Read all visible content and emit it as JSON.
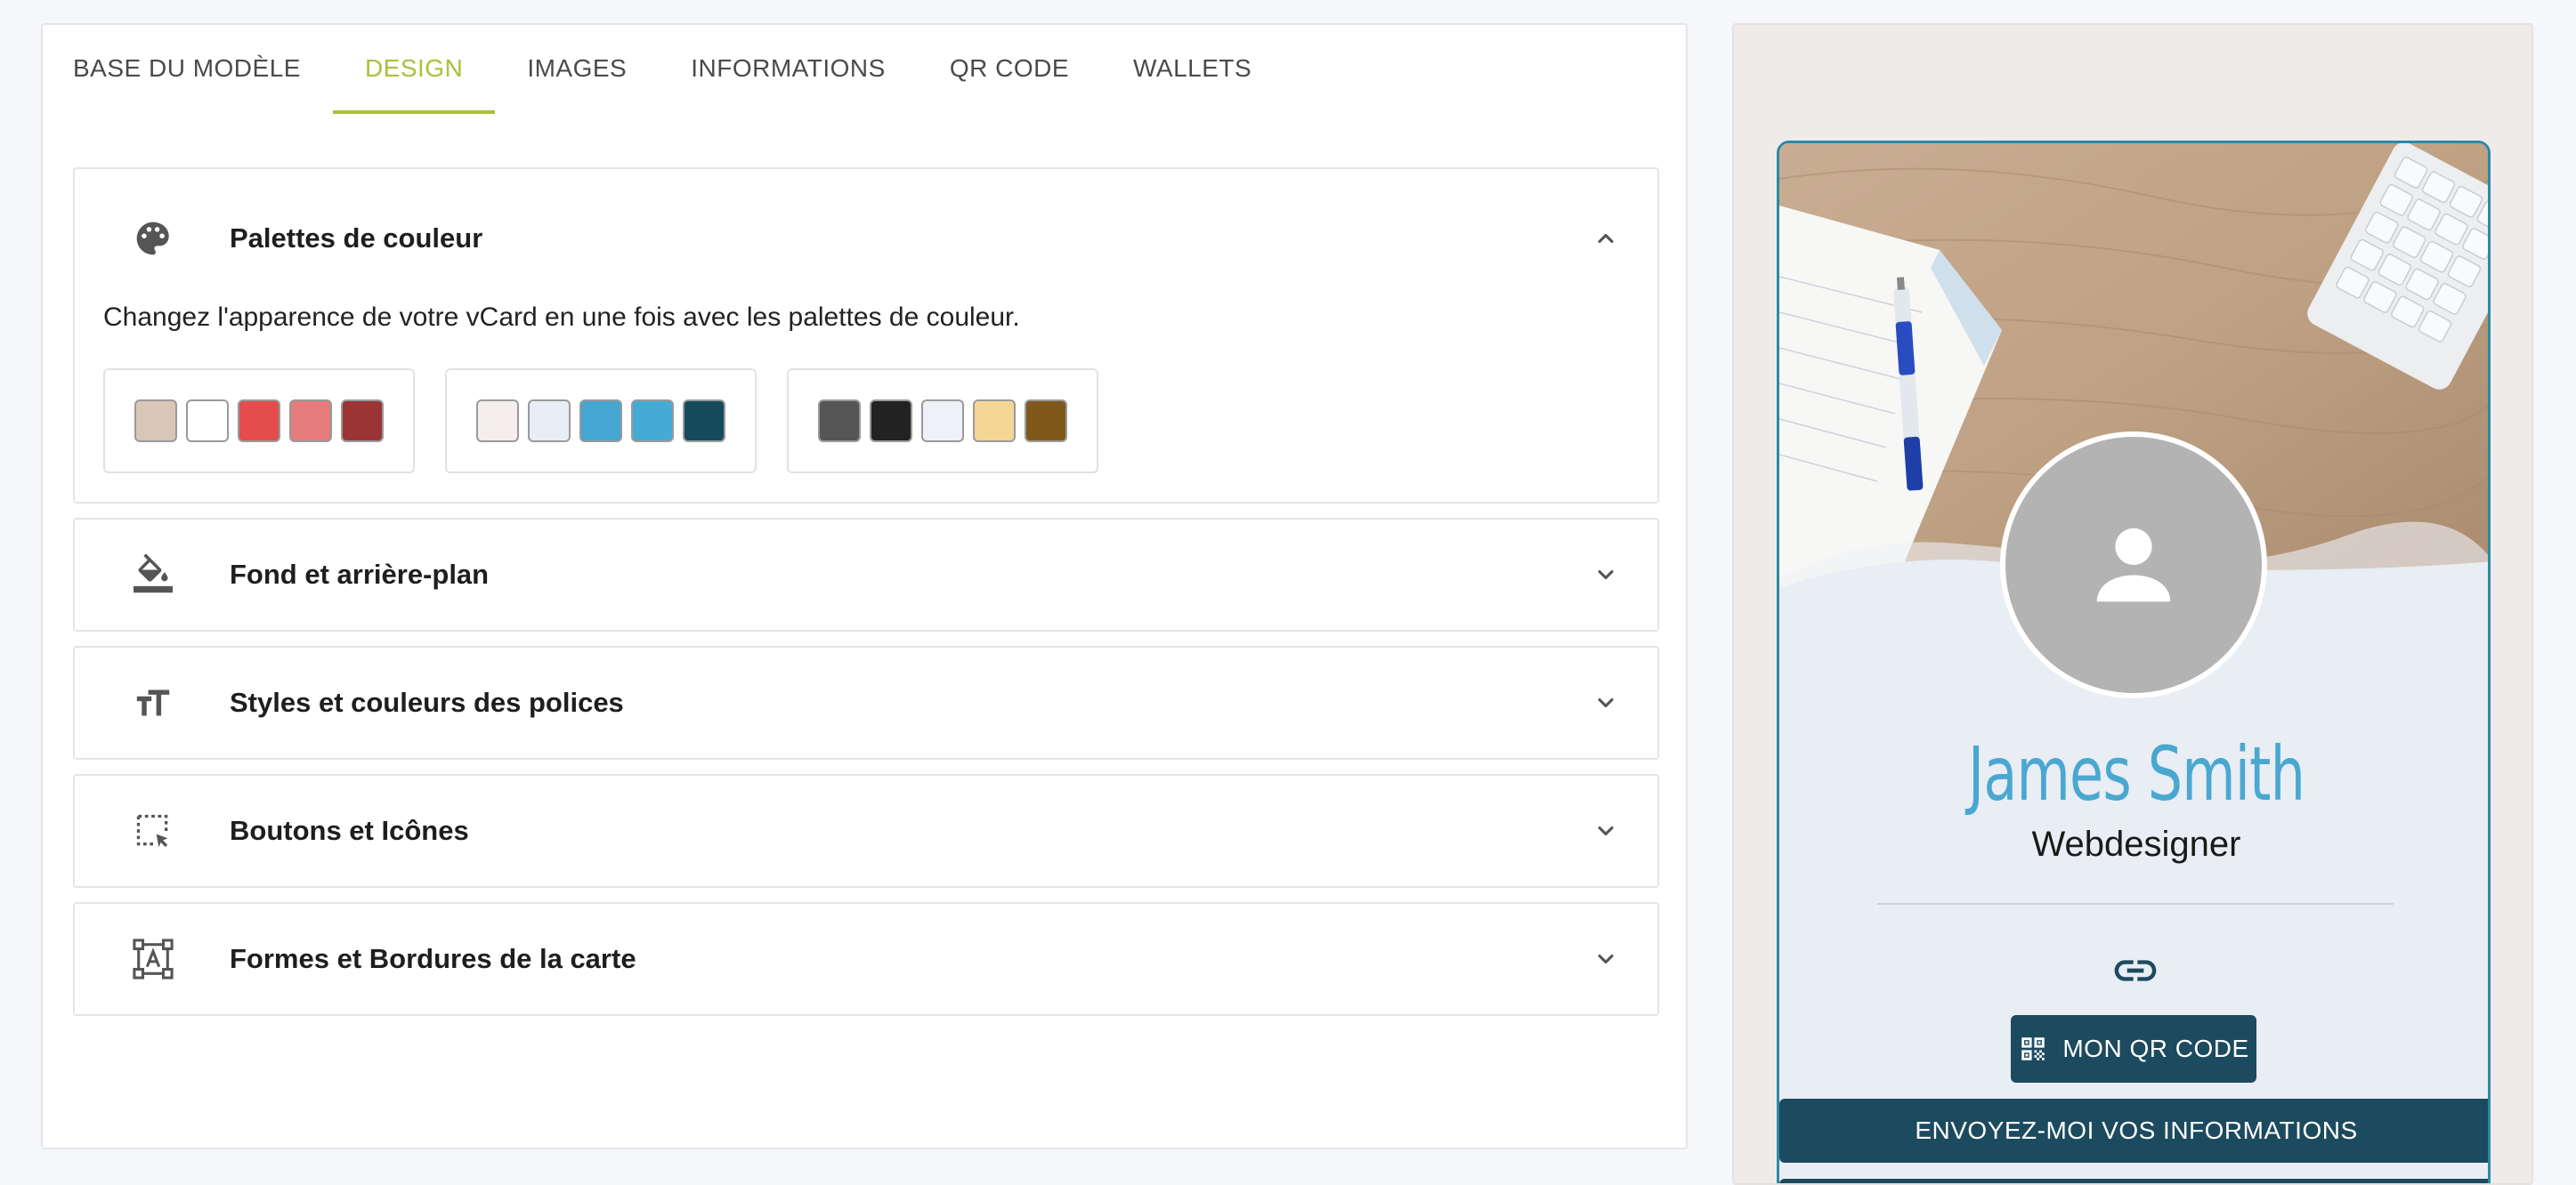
{
  "tabs": [
    {
      "label": "BASE DU MODÈLE",
      "active": false
    },
    {
      "label": "DESIGN",
      "active": true
    },
    {
      "label": "IMAGES",
      "active": false
    },
    {
      "label": "INFORMATIONS",
      "active": false
    },
    {
      "label": "QR CODE",
      "active": false
    },
    {
      "label": "WALLETS",
      "active": false
    }
  ],
  "colors": {
    "accent": "#a8c23a",
    "dark_teal": "#1c4a5e",
    "name_blue": "#4aa8d0"
  },
  "sections": [
    {
      "title": "Palettes de couleur",
      "icon": "palette-icon",
      "open": true
    },
    {
      "title": "Fond et arrière-plan",
      "icon": "paint-bucket-icon",
      "open": false
    },
    {
      "title": "Styles et couleurs des polices",
      "icon": "text-size-icon",
      "open": false
    },
    {
      "title": "Boutons et Icônes",
      "icon": "select-click-icon",
      "open": false
    },
    {
      "title": "Formes et Bordures de la carte",
      "icon": "shape-text-icon",
      "open": false
    }
  ],
  "palette_section": {
    "description": "Changez l'apparence de votre vCard en une fois avec les palettes de couleur.",
    "palettes": [
      [
        "#d8c6b6",
        "#ffffff",
        "#e54d4d",
        "#e57b7b",
        "#9b3535"
      ],
      [
        "#f5eeee",
        "#e8edf6",
        "#44a6d1",
        "#44acd4",
        "#154a5d"
      ],
      [
        "#555555",
        "#222222",
        "#eef1f5",
        "#f6d694",
        "#80591a"
      ]
    ]
  },
  "preview": {
    "name": "James Smith",
    "job": "Webdesigner",
    "qr_button": "MON QR CODE",
    "send_button": "ENVOYEZ-MOI VOS INFORMATIONS"
  }
}
